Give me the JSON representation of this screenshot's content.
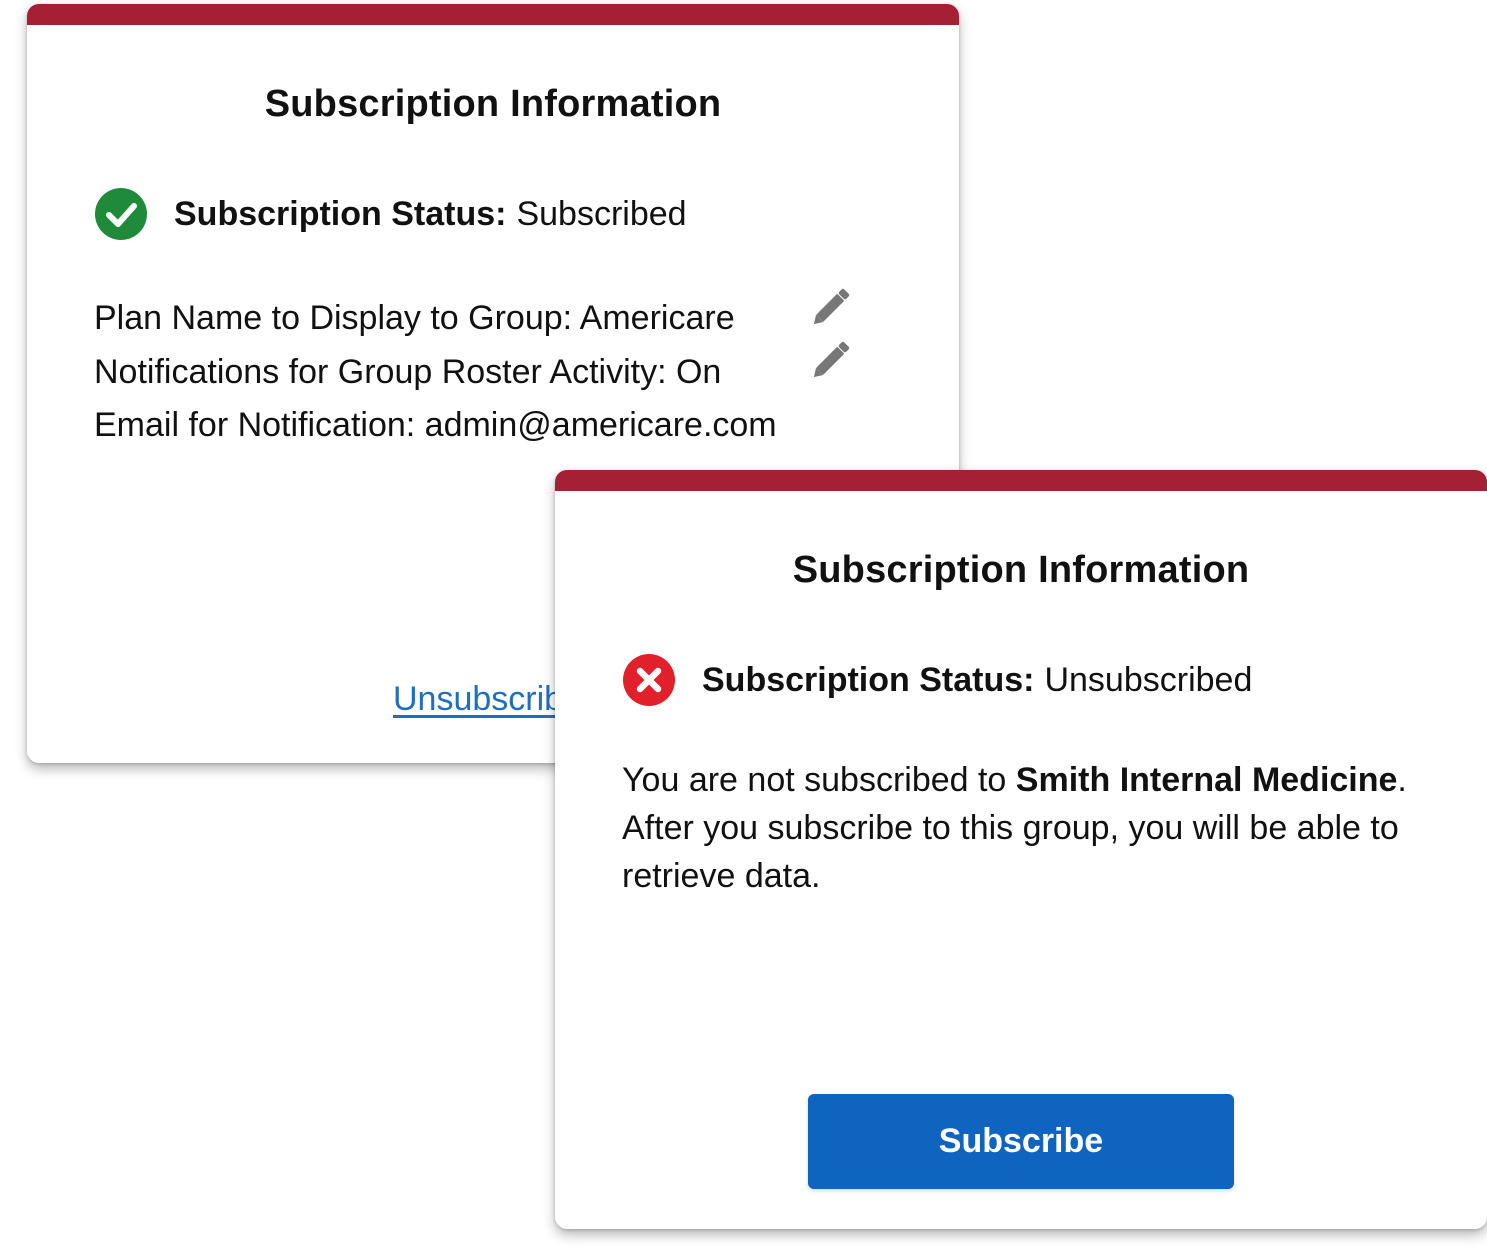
{
  "subscribed_card": {
    "title": "Subscription Information",
    "status_label": "Subscription Status:",
    "status_value": "Subscribed",
    "status_icon": "check-circle-icon",
    "plan_name_line": "Plan Name to Display to Group: Americare",
    "notifications_line": "Notifications for Group Roster Activity: On",
    "email_line": "Email for Notification: admin@americare.com",
    "unsubscribe_link": "Unsubscribe",
    "edit_icon": "pencil-icon"
  },
  "unsubscribed_card": {
    "title": "Subscription Information",
    "status_label": "Subscription Status:",
    "status_value": "Unsubscribed",
    "status_icon": "x-circle-icon",
    "message_prefix": "You are not subscribed to ",
    "message_group": "Smith Internal Medicine",
    "message_suffix": ". After you subscribe to this group, you will be able to retrieve data.",
    "subscribe_button": "Subscribe"
  },
  "colors": {
    "accent_bar": "#a51f35",
    "success": "#1f8a3a",
    "error": "#e0202a",
    "link": "#1f6fbd",
    "primary_button": "#0f64c0"
  }
}
